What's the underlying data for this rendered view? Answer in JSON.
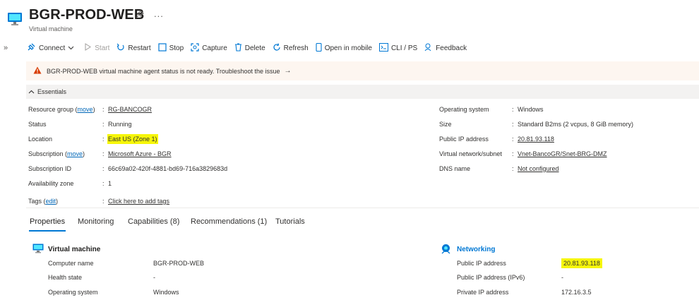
{
  "header": {
    "title": "BGR-PROD-WEB",
    "subtitle": "Virtual machine",
    "more": "..."
  },
  "toolbar": {
    "connect": "Connect",
    "start": "Start",
    "restart": "Restart",
    "stop": "Stop",
    "capture": "Capture",
    "delete": "Delete",
    "refresh": "Refresh",
    "open_mobile": "Open in mobile",
    "cli": "CLI / PS",
    "feedback": "Feedback"
  },
  "warning": {
    "text": "BGR-PROD-WEB virtual machine agent status is not ready. Troubleshoot the issue",
    "arrow": "→"
  },
  "essentials": {
    "title": "Essentials",
    "left": [
      {
        "label": "Resource group",
        "action": "move",
        "value": "RG-BANCOGR",
        "link": true
      },
      {
        "label": "Status",
        "value": "Running"
      },
      {
        "label": "Location",
        "value": "East US (Zone 1)",
        "highlight": true
      },
      {
        "label": "Subscription",
        "action": "move",
        "value": "Microsoft Azure - BGR",
        "link": true
      },
      {
        "label": "Subscription ID",
        "value": "66c69a02-420f-4881-bd69-716a3829683d"
      },
      {
        "label": "Availability zone",
        "value": "1"
      },
      {
        "label": "Tags",
        "action": "edit",
        "value": "Click here to add tags",
        "link": true
      }
    ],
    "right": [
      {
        "label": "Operating system",
        "value": "Windows"
      },
      {
        "label": "Size",
        "value": "Standard B2ms (2 vcpus, 8 GiB memory)"
      },
      {
        "label": "Public IP address",
        "value": "20.81.93.118",
        "link": true
      },
      {
        "label": "Virtual network/subnet",
        "value": "Vnet-BancoGR/Snet-BRG-DMZ",
        "link": true
      },
      {
        "label": "DNS name",
        "value": "Not configured",
        "link": true
      }
    ]
  },
  "tabs": [
    "Properties",
    "Monitoring",
    "Capabilities (8)",
    "Recommendations (1)",
    "Tutorials"
  ],
  "vm_section": {
    "title": "Virtual machine",
    "rows": [
      {
        "label": "Computer name",
        "value": "BGR-PROD-WEB"
      },
      {
        "label": "Health state",
        "value": "-"
      },
      {
        "label": "Operating system",
        "value": "Windows"
      }
    ]
  },
  "net_section": {
    "title": "Networking",
    "rows": [
      {
        "label": "Public IP address",
        "value": "20.81.93.118",
        "highlight": true
      },
      {
        "label": "Public IP address (IPv6)",
        "value": "-"
      },
      {
        "label": "Private IP address",
        "value": "172.16.3.5"
      }
    ]
  },
  "colors": {
    "accent": "#0078d4",
    "link": "#0067b8",
    "highlight": "#f6f60a",
    "warning_bg": "#fdf6f0",
    "warning_icon": "#d83b01"
  }
}
